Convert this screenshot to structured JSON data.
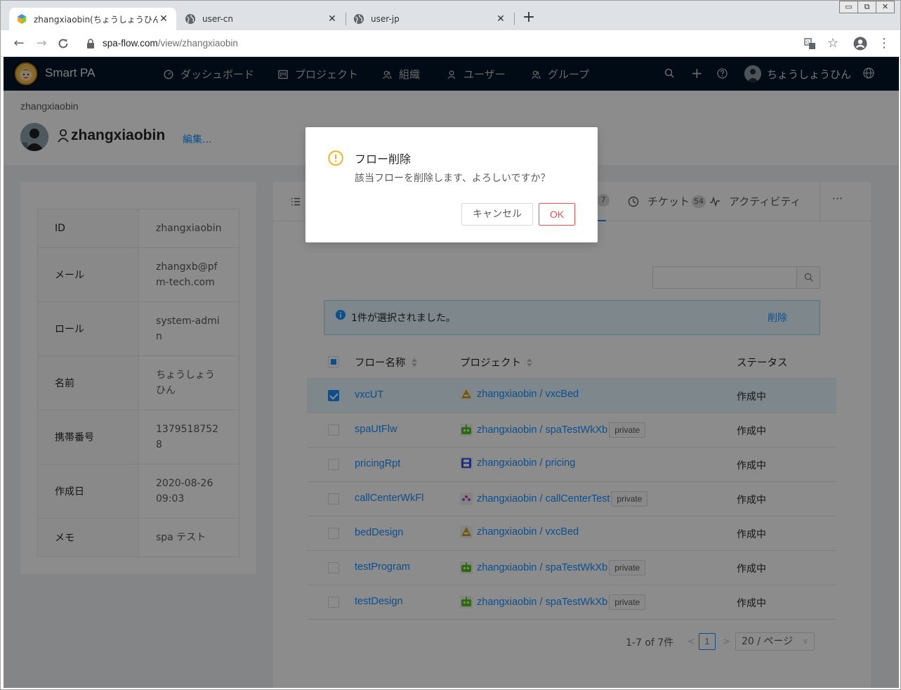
{
  "browser": {
    "tabs": [
      {
        "label": "zhangxiaobin(ちょうしょうひん)",
        "active": true
      },
      {
        "label": "user-cn",
        "active": false
      },
      {
        "label": "user-jp",
        "active": false
      }
    ],
    "window_controls": [
      "▭",
      "⧉",
      "✕"
    ],
    "url_host": "spa-flow.com",
    "url_path": "/view/zhangxiaobin"
  },
  "navbar": {
    "brand": "Smart PA",
    "items": [
      {
        "label": "ダッシュボード",
        "icon": "dashboard-icon"
      },
      {
        "label": "プロジェクト",
        "icon": "project-icon"
      },
      {
        "label": "組織",
        "icon": "team-icon"
      },
      {
        "label": "ユーザー",
        "icon": "user-icon"
      },
      {
        "label": "グループ",
        "icon": "group-icon"
      }
    ],
    "user_name": "ちょうしょうひん"
  },
  "header": {
    "breadcrumb": "zhangxiaobin",
    "title": "zhangxiaobin",
    "edit_label": "編集..."
  },
  "profile": {
    "rows": [
      {
        "key": "ID",
        "value": "zhangxiaobin"
      },
      {
        "key": "メール",
        "value": "zhangxb@pfm-tech.com"
      },
      {
        "key": "ロール",
        "value": "system-admin"
      },
      {
        "key": "名前",
        "value": "ちょうしょうひん"
      },
      {
        "key": "携帯番号",
        "value": "13795187528"
      },
      {
        "key": "作成日",
        "value": "2020-08-26 09:03"
      },
      {
        "key": "メモ",
        "value": "spa テスト"
      }
    ]
  },
  "tabs": {
    "flow_badge": "7",
    "ticket_label": "チケット",
    "ticket_badge": "54",
    "activity_label": "アクティビティ",
    "more": "···"
  },
  "selection_alert": {
    "text": "1件が選択されました。",
    "action": "削除"
  },
  "table": {
    "columns": {
      "name": "フロー名称",
      "project": "プロジェクト",
      "status": "ステータス"
    },
    "rows": [
      {
        "name": "vxcUT",
        "project": "zhangxiaobin / vxcBed",
        "private": "",
        "status": "作成中",
        "selected": true,
        "icon": "triangle-project-icon",
        "color": "#c9a227"
      },
      {
        "name": "spaUtFlw",
        "project": "zhangxiaobin / spaTestWkXb",
        "private": "private",
        "status": "作成中",
        "selected": false,
        "icon": "robot-project-icon",
        "color": "#52c41a"
      },
      {
        "name": "pricingRpt",
        "project": "zhangxiaobin / pricing",
        "private": "",
        "status": "作成中",
        "selected": false,
        "icon": "disk-project-icon",
        "color": "#2f54eb"
      },
      {
        "name": "callCenterWkFl",
        "project": "zhangxiaobin / callCenterTest",
        "private": "private",
        "status": "作成中",
        "selected": false,
        "icon": "dots-project-icon",
        "color": "#9254de"
      },
      {
        "name": "bedDesign",
        "project": "zhangxiaobin / vxcBed",
        "private": "",
        "status": "作成中",
        "selected": false,
        "icon": "triangle-project-icon",
        "color": "#c9a227"
      },
      {
        "name": "testProgram",
        "project": "zhangxiaobin / spaTestWkXb",
        "private": "private",
        "status": "作成中",
        "selected": false,
        "icon": "robot-project-icon",
        "color": "#52c41a"
      },
      {
        "name": "testDesign",
        "project": "zhangxiaobin / spaTestWkXb",
        "private": "private",
        "status": "作成中",
        "selected": false,
        "icon": "robot-project-icon",
        "color": "#52c41a"
      }
    ]
  },
  "pagination": {
    "total": "1-7 of 7件",
    "current": "1",
    "page_size": "20 / ページ"
  },
  "modal": {
    "title": "フロー削除",
    "content": "該当フローを削除します、よろしいですか？",
    "cancel": "キャンセル",
    "ok": "OK"
  },
  "colors": {
    "primary": "#1890ff",
    "navbar": "#001529",
    "warning": "#faad14",
    "danger": "#ff4d4f"
  }
}
